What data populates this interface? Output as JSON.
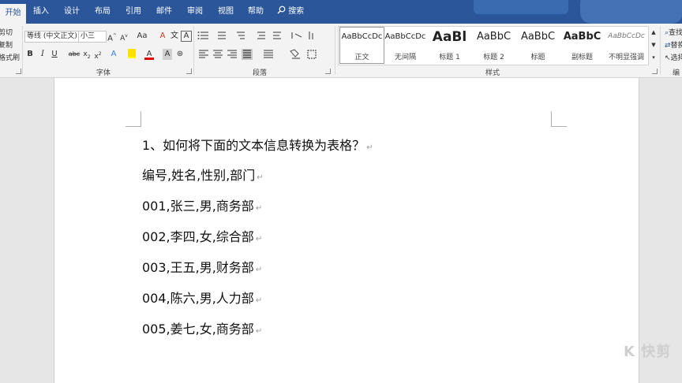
{
  "tabs": [
    "开始",
    "插入",
    "设计",
    "布局",
    "引用",
    "邮件",
    "审阅",
    "视图",
    "帮助"
  ],
  "search_label": "搜索",
  "clipboard": {
    "cut": "剪切",
    "copy": "复制",
    "format_painter": "格式刷"
  },
  "font": {
    "name": "等线 (中文正文)",
    "size": "小三",
    "group_label": "字体"
  },
  "paragraph": {
    "group_label": "段落"
  },
  "styles": {
    "group_label": "样式",
    "items": [
      {
        "sample": "AaBbCcDc",
        "name": "正文",
        "selected": true
      },
      {
        "sample": "AaBbCcDc",
        "name": "无间隔"
      },
      {
        "sample": "AaBl",
        "name": "标题 1"
      },
      {
        "sample": "AaBbC",
        "name": "标题 2"
      },
      {
        "sample": "AaBbC",
        "name": "标题"
      },
      {
        "sample": "AaBbC",
        "name": "副标题"
      },
      {
        "sample": "AaBbCcDc",
        "name": "不明显强调"
      }
    ]
  },
  "editing": {
    "find": "查找",
    "replace": "替换",
    "select": "选择",
    "group_label": "编辑"
  },
  "document": {
    "lines": [
      "1、如何将下面的文本信息转换为表格？",
      "编号,姓名,性别,部门",
      "001,张三,男,商务部",
      "002,李四,女,综合部",
      "003,王五,男,财务部",
      "004,陈六,男,人力部",
      "005,姜七,女,商务部"
    ],
    "paragraph_mark": "↵"
  },
  "watermark": "K 快剪",
  "colors": {
    "accent": "#2b579a",
    "highlight": "#ffff00",
    "font_color": "#e00000"
  }
}
